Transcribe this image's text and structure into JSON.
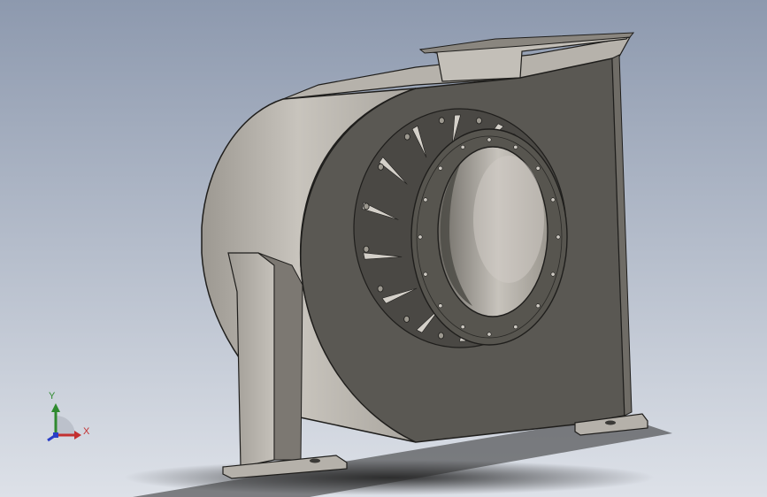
{
  "viewport": {
    "background_top": "#8d99ae",
    "background_bottom": "#dde1e8"
  },
  "model": {
    "kind": "centrifugal fan housing",
    "body_color": "#5a5853",
    "scroll_color": "#bcb8b1",
    "edge_color": "#1f1e1c",
    "highlight_color": "#d6d3cd",
    "shadow_color": "#2b2b2b",
    "inlet_flange_bolts": 16,
    "outer_bolt_ring_holes": 16,
    "inlet_vanes": 14
  },
  "triad": {
    "x_label": "X",
    "y_label": "Y",
    "x_color": "#c33030",
    "y_color": "#2f8a2f",
    "z_color": "#2b3fc7"
  }
}
